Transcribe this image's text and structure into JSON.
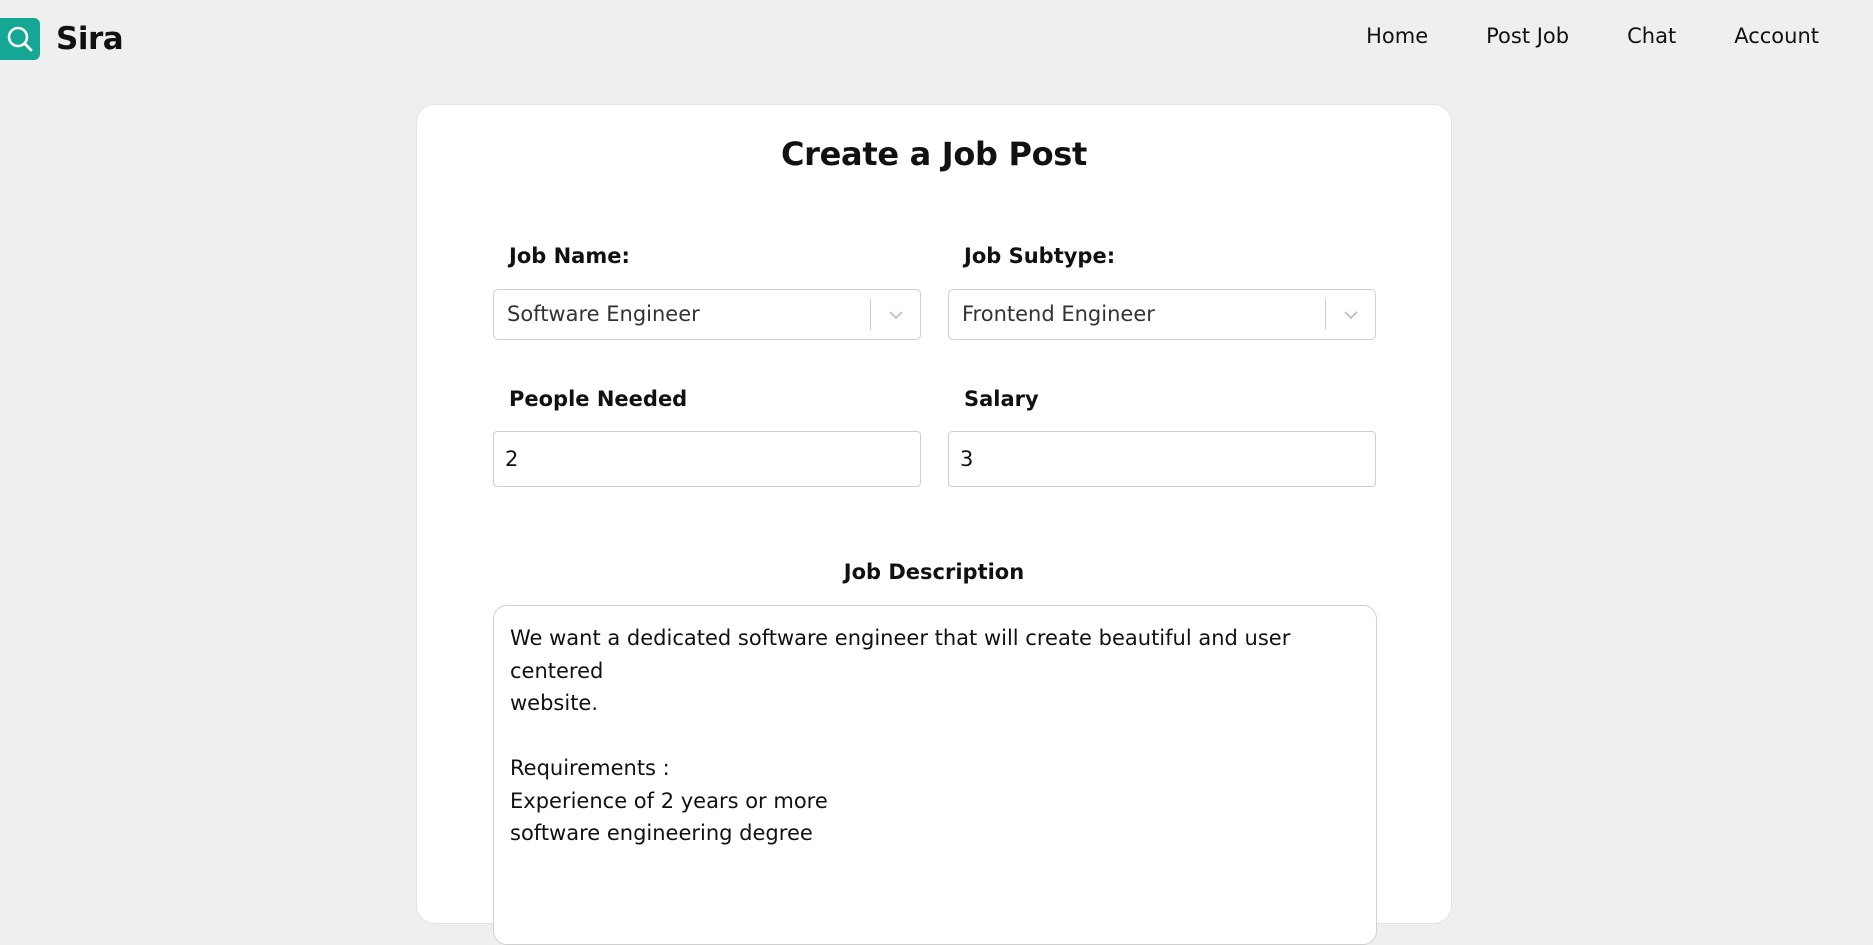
{
  "navbar": {
    "brand_name": "Sira",
    "brand_icon": "search-icon",
    "brand_color": "#14a894",
    "links": [
      "Home",
      "Post Job",
      "Chat",
      "Account"
    ]
  },
  "form": {
    "title": "Create a Job Post",
    "job_name": {
      "label": "Job Name:",
      "value": "Software Engineer"
    },
    "job_subtype": {
      "label": "Job Subtype:",
      "value": "Frontend Engineer"
    },
    "people_needed": {
      "label": "People Needed",
      "value": "2"
    },
    "salary": {
      "label": "Salary",
      "value": "3"
    },
    "description": {
      "label": "Job Description",
      "lines": [
        "We want a dedicated software engineer that will create beautiful and user centered",
        "website.",
        "",
        "Requirements :",
        "Experience of 2 years or more",
        "software engineering degree"
      ]
    }
  }
}
